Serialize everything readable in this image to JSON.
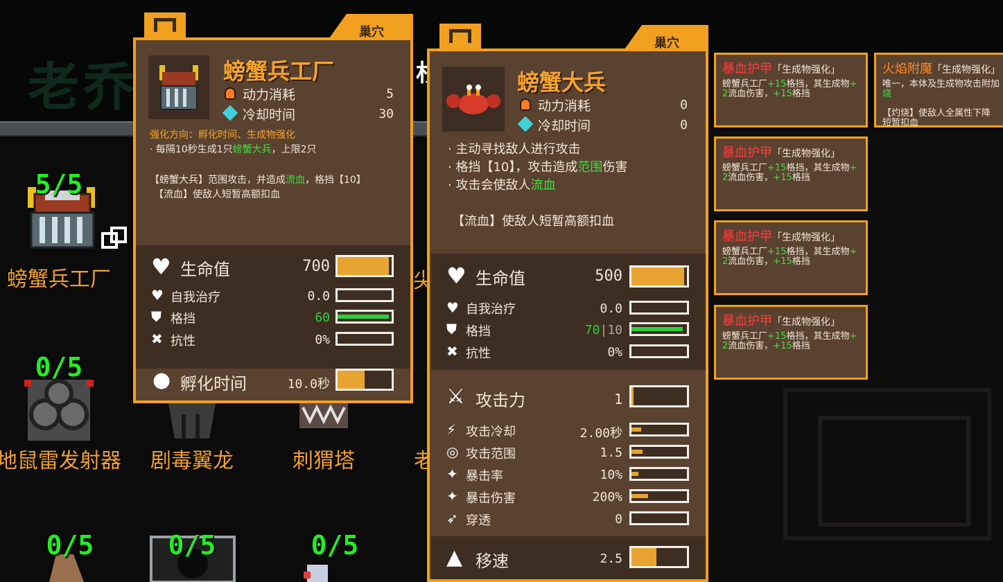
{
  "towers": [
    {
      "name": "螃蟹兵工厂",
      "count": "5/5"
    },
    {
      "name": "地鼠雷发射器",
      "count": "0/5"
    },
    {
      "name": "剧毒翼龙",
      "count": ""
    },
    {
      "name": "刺猬塔",
      "count": ""
    },
    {
      "name": "",
      "count": "0/5"
    },
    {
      "name": "",
      "count": "0/5"
    },
    {
      "name": "",
      "count": "0/5"
    }
  ],
  "bg_chars": {
    "c1": "杉",
    "c2": "尖",
    "c3": "老"
  },
  "factory_panel": {
    "tab": "巢穴",
    "title": "螃蟹兵工厂",
    "power_label": "动力消耗",
    "power_value": "5",
    "cooldown_label": "冷却时间",
    "cooldown_value": "30",
    "upgrade_line": "强化方向：孵化时间、生成物强化",
    "spawn_pre": "· 每隔10秒生成1只",
    "spawn_unit": "螃蟹大兵",
    "spawn_post": "，上限2只",
    "note1_pre": "【螃蟹大兵】范围攻击，并造成",
    "note1_hl": "流血",
    "note1_post": "，格挡【10】",
    "note2": "【流血】使敌人短暂高额扣血",
    "hp_label": "生命值",
    "hp_value": "700",
    "hp_fill": 0.95,
    "heal_label": "自我治疗",
    "heal_value": "0.0",
    "block_label": "格挡",
    "block_value": "60",
    "block_fill": 0.95,
    "resist_label": "抗性",
    "resist_value": "0%",
    "hatch_label": "孵化时间",
    "hatch_value": "10.0秒",
    "hatch_fill": 0.5
  },
  "soldier_panel": {
    "tab": "巢穴",
    "title": "螃蟹大兵",
    "power_label": "动力消耗",
    "power_value": "0",
    "cooldown_label": "冷却时间",
    "cooldown_value": "0",
    "line1": "· 主动寻找敌人进行攻击",
    "line2_pre": "· 格挡【10】，攻击造成",
    "line2_hl": "范围",
    "line2_post": "伤害",
    "line3_pre": "· 攻击会使敌人",
    "line3_hl": "流血",
    "note": "【流血】使敌人短暂高额扣血",
    "hp_label": "生命值",
    "hp_value": "500",
    "hp_fill": 0.95,
    "heal_label": "自我治疗",
    "heal_value": "0.0",
    "block_label": "格挡",
    "block_value_green": "70",
    "block_value_sep": "|",
    "block_value_grey": "10",
    "block_fill": 0.92,
    "resist_label": "抗性",
    "resist_value": "0%",
    "atk_label": "攻击力",
    "atk_value": "1",
    "atk_fill": 0.04,
    "atk_cd_label": "攻击冷却",
    "atk_cd_value": "2.00秒",
    "atk_cd_fill": 0.18,
    "range_label": "攻击范围",
    "range_value": "1.5",
    "range_fill": 0.2,
    "crit_label": "暴击率",
    "crit_value": "10%",
    "crit_fill": 0.12,
    "critdmg_label": "暴击伤害",
    "critdmg_value": "200%",
    "critdmg_fill": 0.3,
    "pierce_label": "穿透",
    "pierce_value": "0",
    "pierce_fill": 0,
    "speed_label": "移速",
    "speed_value": "2.5",
    "speed_fill": 0.45
  },
  "enchant_cards": [
    {
      "title": "暴血护甲",
      "tag": "「生成物强化」",
      "d1a": "螃蟹兵工厂",
      "d1b": "+15",
      "d1c": "格挡，其生成物",
      "d1d": "+",
      "d2a": "2",
      "d2b": "流血伤害，",
      "d2c": "+15",
      "d2d": "格挡"
    },
    {
      "title": "暴血护甲",
      "tag": "「生成物强化」",
      "d1a": "螃蟹兵工厂",
      "d1b": "+15",
      "d1c": "格挡，其生成物",
      "d1d": "+",
      "d2a": "2",
      "d2b": "流血伤害，",
      "d2c": "+15",
      "d2d": "格挡"
    },
    {
      "title": "暴血护甲",
      "tag": "「生成物强化」",
      "d1a": "螃蟹兵工厂",
      "d1b": "+15",
      "d1c": "格挡，其生成物",
      "d1d": "+",
      "d2a": "2",
      "d2b": "流血伤害，",
      "d2c": "+15",
      "d2d": "格挡"
    },
    {
      "title": "暴血护甲",
      "tag": "「生成物强化」",
      "d1a": "螃蟹兵工厂",
      "d1b": "+15",
      "d1c": "格挡，其生成物",
      "d1d": "+",
      "d2a": "2",
      "d2b": "流血伤害，",
      "d2c": "+15",
      "d2d": "格挡"
    }
  ],
  "fire_card": {
    "title": "火焰附魔",
    "tag": "「生成物强化」",
    "d1": "唯一，本体及生成物攻击附加",
    "d1b": "烧",
    "d2": "【灼烧】使敌人全属性下降",
    "d3": "短暂扣血"
  },
  "colors": {
    "panel_border": "#f2a020",
    "panel_bg": "#5a4230",
    "count_green": "#22ee22",
    "title_orange": "#f6a32b",
    "bar_fill": "#e8a430",
    "block_green": "#2ed03a"
  }
}
